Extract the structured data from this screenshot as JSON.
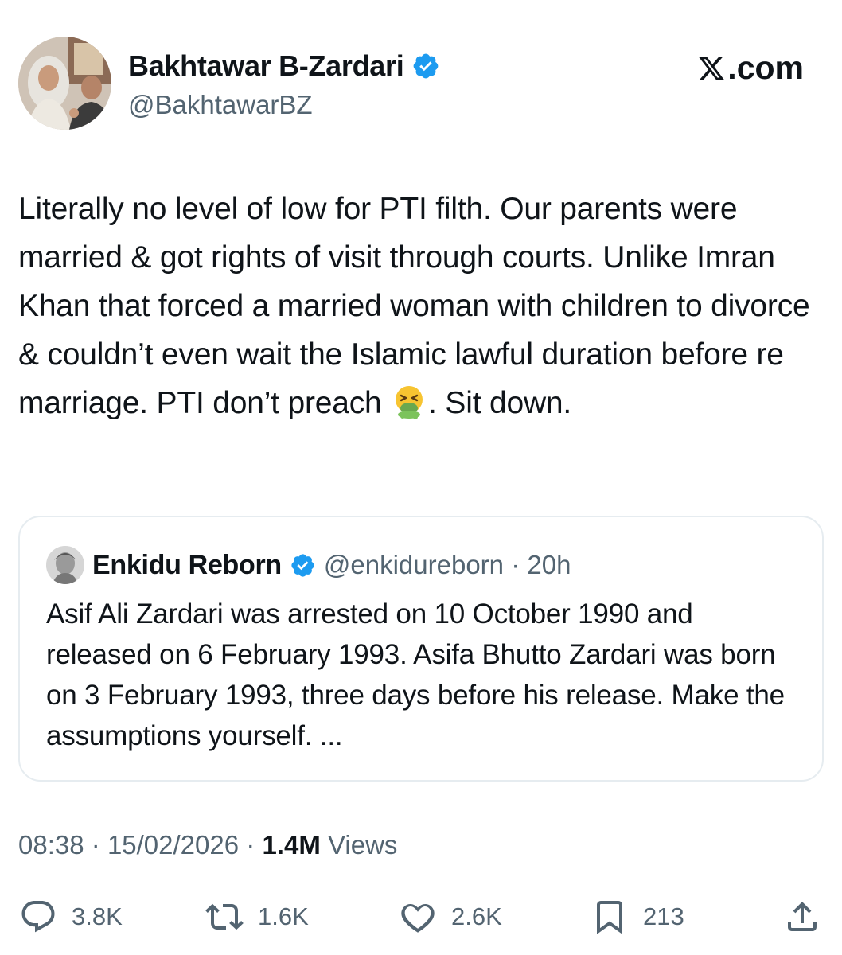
{
  "author": {
    "name": "Bakhtawar B-Zardari",
    "handle": "@BakhtawarBZ",
    "verified": true
  },
  "site_label": ".com",
  "tweet": {
    "text_parts": [
      "Literally no level of low for PTI filth. Our parents were married & got rights of visit through courts. Unlike Imran Khan that forced a married woman with children to divorce & couldn’t even wait the Islamic lawful duration before re marriage. PTI don’t preach ",
      ". Sit down."
    ],
    "emoji_icon": "vomiting-face-icon"
  },
  "quote": {
    "name": "Enkidu Reborn",
    "handle": "@enkidureborn",
    "separator": "·",
    "age": "20h",
    "verified": true,
    "text": "Asif Ali Zardari was arrested on 10 October 1990 and released on 6 February 1993. Asifa Bhutto Zardari was born on 3 February 1993, three days before his release. Make the assumptions yourself. ..."
  },
  "meta": {
    "time": "08:38",
    "date": "15/02/2026",
    "separator": "·",
    "views_count": "1.4M",
    "views_label": "Views"
  },
  "actions": {
    "replies": "3.8K",
    "reposts": "1.6K",
    "likes": "2.6K",
    "bookmarks": "213"
  },
  "colors": {
    "text": "#0f1419",
    "secondary": "#536471",
    "verified": "#1d9bf0",
    "border": "#e6ecf0"
  }
}
